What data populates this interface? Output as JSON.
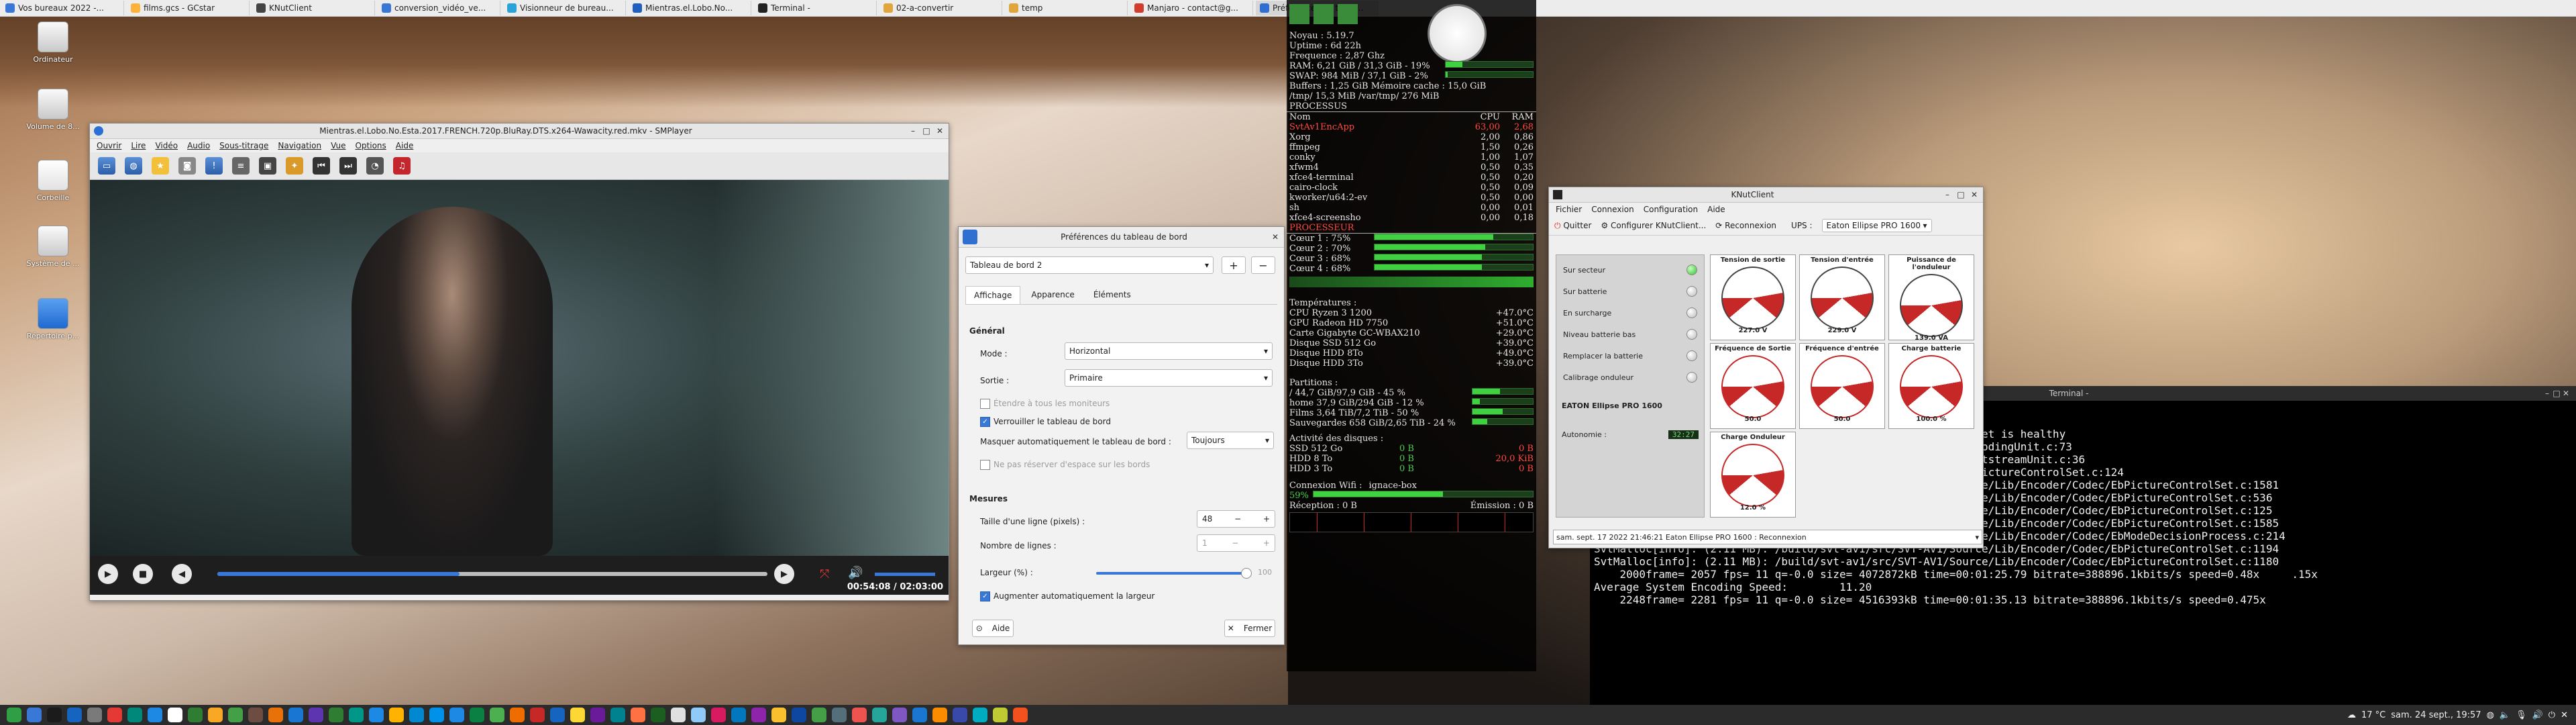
{
  "top_tasks": [
    {
      "label": "Vos bureaux 2022 -...",
      "color": "#3a78d8"
    },
    {
      "label": "films.gcs - GCstar",
      "color": "#ffb23a"
    },
    {
      "label": "KNutClient",
      "color": "#444444"
    },
    {
      "label": "conversion_vidéo_ve...",
      "color": "#3a78d8"
    },
    {
      "label": "Visionneur de bureau...",
      "color": "#2aa3d8"
    },
    {
      "label": "Mientras.el.Lobo.No...",
      "color": "#1f5fbf"
    },
    {
      "label": "Terminal -",
      "color": "#222222"
    },
    {
      "label": "02-a-convertir",
      "color": "#e0a63b"
    },
    {
      "label": "temp",
      "color": "#e0a63b"
    },
    {
      "label": "Manjaro - contact@g...",
      "color": "#d33b2c"
    },
    {
      "label": "Préférences du table...",
      "color": "#2e6fd1"
    }
  ],
  "desktop_icons": [
    {
      "label": "Corbeille"
    },
    {
      "label": "Système de ..."
    },
    {
      "label": "Répertoire p..."
    }
  ],
  "desktop_icons_partial": [
    "Ordinateur",
    "Volume de 8..."
  ],
  "smplayer": {
    "title": "Mientras.el.Lobo.No.Esta.2017.FRENCH.720p.BluRay.DTS.x264-Wawacity.red.mkv - SMPlayer",
    "menu": [
      "Ouvrir",
      "Lire",
      "Vidéo",
      "Audio",
      "Sous-titrage",
      "Navigation",
      "Vue",
      "Options",
      "Aide"
    ],
    "time": "00:54:08 / 02:03:00",
    "progress_fraction": 0.44
  },
  "prefs": {
    "title": "Préférences du tableau de bord",
    "panel_select": "Tableau de bord 2",
    "tabs": [
      "Affichage",
      "Apparence",
      "Éléments"
    ],
    "active_tab": "Affichage",
    "general_heading": "Général",
    "mode_label": "Mode :",
    "mode_value": "Horizontal",
    "output_label": "Sortie :",
    "output_value": "Primaire",
    "extend_label": "Étendre à tous les moniteurs",
    "lock_label": "Verrouiller le tableau de bord",
    "autohide_label": "Masquer automatiquement le tableau de bord :",
    "autohide_value": "Toujours",
    "reserve_label": "Ne pas réserver d'espace sur les bords",
    "measures_heading": "Mesures",
    "row_size_label": "Taille d'une ligne (pixels) :",
    "row_size_value": "48",
    "rows_label": "Nombre de lignes :",
    "rows_value": "1",
    "width_label": "Largeur (%) :",
    "width_value": "100",
    "width_fraction": 1.0,
    "auto_width_label": "Augmenter automatiquement la largeur",
    "help_label": "Aide",
    "close_label": "Fermer"
  },
  "conky": {
    "sys": [
      {
        "k": "Noyau :",
        "v": "5.19.7"
      },
      {
        "k": "Uptime :",
        "v": "6d 22h"
      },
      {
        "k": "Frequence :",
        "v": "2,87 Ghz"
      }
    ],
    "ram_line": "RAM: 6,21 GiB / 31,3 GiB - 19%",
    "ram_fraction": 0.19,
    "swap_line": "SWAP: 984 MiB / 37,1 GiB - 2%",
    "swap_fraction": 0.02,
    "buffers_line": "Buffers : 1,25 GiB Mémoire cache : 15,0 GiB",
    "tmp_line": "/tmp/ 15,3 MiB /var/tmp/ 276 MiB",
    "proc_heading": "PROCESSUS",
    "proc_cols": [
      "Nom",
      "CPU",
      "RAM"
    ],
    "procs": [
      {
        "n": "SvtAv1EncApp",
        "c": "63,00",
        "r": "2,68",
        "hl": true
      },
      {
        "n": "Xorg",
        "c": "2,00",
        "r": "0,86",
        "hl": false
      },
      {
        "n": "ffmpeg",
        "c": "1,50",
        "r": "0,26",
        "hl": false
      },
      {
        "n": "conky",
        "c": "1,00",
        "r": "1,07",
        "hl": false
      },
      {
        "n": "xfwm4",
        "c": "0,50",
        "r": "0,35",
        "hl": false
      },
      {
        "n": "xfce4-terminal",
        "c": "0,50",
        "r": "0,20",
        "hl": false
      },
      {
        "n": "cairo-clock",
        "c": "0,50",
        "r": "0,09",
        "hl": false
      },
      {
        "n": "kworker/u64:2-ev",
        "c": "0,50",
        "r": "0,00",
        "hl": false
      },
      {
        "n": "sh",
        "c": "0,00",
        "r": "0,01",
        "hl": false
      },
      {
        "n": "xfce4-screensho",
        "c": "0,00",
        "r": "0,18",
        "hl": false
      }
    ],
    "cpu_heading": "PROCESSEUR",
    "cores": [
      {
        "k": "Cœur 1 : 75%",
        "f": 0.75
      },
      {
        "k": "Cœur 2 : 70%",
        "f": 0.7
      },
      {
        "k": "Cœur 3 : 68%",
        "f": 0.68
      },
      {
        "k": "Cœur 4 : 68%",
        "f": 0.68
      }
    ],
    "temp_heading": "Températures :",
    "temps": [
      {
        "k": "CPU Ryzen 3 1200",
        "v": "+47.0°C"
      },
      {
        "k": "GPU Radeon HD 7750",
        "v": "+51.0°C"
      },
      {
        "k": "Carte Gigabyte GC-WBAX210",
        "v": "+29.0°C"
      },
      {
        "k": "Disque SSD 512 Go",
        "v": "+39.0°C"
      },
      {
        "k": "Disque HDD 8To",
        "v": "+49.0°C"
      },
      {
        "k": "Disque HDD 3To",
        "v": "+39.0°C"
      }
    ],
    "part_heading": "Partitions :",
    "parts": [
      {
        "k": "/ 44,7 GiB/97,9 GiB - 45 %",
        "f": 0.45
      },
      {
        "k": "home 37,9 GiB/294 GiB - 12 %",
        "f": 0.12
      },
      {
        "k": "Films 3,64 TiB/7,2 TiB - 50 %",
        "f": 0.5
      },
      {
        "k": "Sauvegardes 658 GiB/2,65 TiB - 24 %",
        "f": 0.24
      }
    ],
    "disk_heading": "Activité des disques :",
    "disks": [
      {
        "k": "SSD 512 Go",
        "a": "0 B",
        "b": "0 B"
      },
      {
        "k": "HDD 8 To",
        "a": "0 B",
        "b": "20,0 KiB"
      },
      {
        "k": "HDD 3 To",
        "a": "0 B",
        "b": "0 B"
      }
    ],
    "wifi_label": "Connexion Wifi :",
    "wifi_name": "ignace-box",
    "wifi_pct": "59%",
    "wifi_fraction": 0.59,
    "rx_line": "Réception : 0 B",
    "tx_line": "Émission : 0 B"
  },
  "knut": {
    "title": "KNutClient",
    "menu": [
      "Fichier",
      "Connexion",
      "Configuration",
      "Aide"
    ],
    "quit_label": "Quitter",
    "config_label": "Configurer KNutClient...",
    "reconnect_label": "Reconnexion",
    "ups_label": "UPS :",
    "ups_value": "Eaton Ellipse PRO 1600",
    "status": [
      {
        "k": "Sur secteur",
        "on": true
      },
      {
        "k": "Sur batterie",
        "on": false
      },
      {
        "k": "En surcharge",
        "on": false
      },
      {
        "k": "Niveau batterie bas",
        "on": false
      },
      {
        "k": "Remplacer la batterie",
        "on": false
      },
      {
        "k": "Calibrage onduleur",
        "on": false
      }
    ],
    "model": "EATON Ellipse PRO 1600",
    "autonomy_label": "Autonomie :",
    "autonomy_value": "32:27",
    "gauges": [
      {
        "t": "Tension de sortie",
        "v": "227.0",
        "u": "V"
      },
      {
        "t": "Tension d'entrée",
        "v": "229.0",
        "u": "V"
      },
      {
        "t": "Puissance de l'onduleur",
        "v": "139.0",
        "u": "VA"
      },
      {
        "t": "Fréquence de Sortie",
        "v": "50.0",
        "u": ""
      },
      {
        "t": "Fréquence d'entrée",
        "v": "50.0",
        "u": ""
      },
      {
        "t": "Charge batterie",
        "v": "100.0",
        "u": "%"
      },
      {
        "t": "Charge Onduleur",
        "v": "12.0",
        "u": "%"
      }
    ],
    "statusbar": "sam. sept. 17 2022 21:46:21 Eaton Ellipse PRO 1600 : Reconnexion"
  },
  "terminal": {
    "title": "Terminal -",
    "lines": [
      "                                                          cket is healthy",
      "                               /Source/Lib/Encoder/Codec/EbCodingUnit.c:73",
      "                               /Source/Lib/Common/Codec/EbBitstreamUnit.c:36",
      "                               /Source/Lib/Encoder/Codec/EbPictureControlSet.c:124",
      "SvtMalloc[info]: (6.16 MB): /build/svt-av1/src/SVT-AV1/Source/Lib/Encoder/Codec/EbPictureControlSet.c:1581",
      "SvtMalloc[info]: (4.87 MB): /build/svt-av1/src/SVT-AV1/Source/Lib/Encoder/Codec/EbPictureControlSet.c:536",
      "SvtMalloc[info]: (4.46 MB): /build/svt-av1/src/SVT-AV1/Source/Lib/Encoder/Codec/EbPictureControlSet.c:125",
      "SvtMalloc[info]: (3.42 MB): /build/svt-av1/src/SVT-AV1/Source/Lib/Encoder/Codec/EbPictureControlSet.c:1585",
      "SvtMalloc[info]: (2.67 MB): /build/svt-av1/src/SVT-AV1/Source/Lib/Encoder/Codec/EbModeDecisionProcess.c:214",
      "SvtMalloc[info]: (2.11 MB): /build/svt-av1/src/SVT-AV1/Source/Lib/Encoder/Codec/EbPictureControlSet.c:1194",
      "SvtMalloc[info]: (2.11 MB): /build/svt-av1/src/SVT-AV1/Source/Lib/Encoder/Codec/EbPictureControlSet.c:1180",
      "    2000frame= 2057 fps= 11 q=-0.0 size= 4072872kB time=00:01:25.79 bitrate=388896.1kbits/s speed=0.48x     .15x",
      "Average System Encoding Speed:        11.20",
      "    2248frame= 2281 fps= 11 q=-0.0 size= 4516393kB time=00:01:35.13 bitrate=388896.1kbits/s speed=0.475x"
    ]
  },
  "bottom_icons": [
    "#2f9e44",
    "#3a78d8",
    "#1b1b1b",
    "#1565c0",
    "#7a7a7a",
    "#e53935",
    "#00897b",
    "#1e88e5",
    "#ffffff",
    "#2e7d32",
    "#f9a825",
    "#43a047",
    "#6d4c41",
    "#e8710a",
    "#1976d2",
    "#5e35b1",
    "#2e7d32",
    "#009688",
    "#1e88e5",
    "#ffb300",
    "#0288d1",
    "#0091ea",
    "#1e88e5",
    "#0b8043",
    "#4caf50",
    "#ef6c00",
    "#c62828",
    "#1565c0",
    "#fdd835",
    "#6a1b9a",
    "#00838f",
    "#ff7043",
    "#1b5e20",
    "#e0e0e0",
    "#90caf9",
    "#d81b60",
    "#0277bd",
    "#8e24aa",
    "#fbc02d",
    "#0d47a1",
    "#43a047",
    "#546e7a",
    "#ef5350",
    "#26a69a",
    "#7e57c2",
    "#1976d2",
    "#fb8c00",
    "#3949ab",
    "#00acc1",
    "#c0ca33",
    "#f4511e"
  ],
  "clock": {
    "weather": "17 °C",
    "datetime": "sam. 24 sept., 19:57"
  }
}
